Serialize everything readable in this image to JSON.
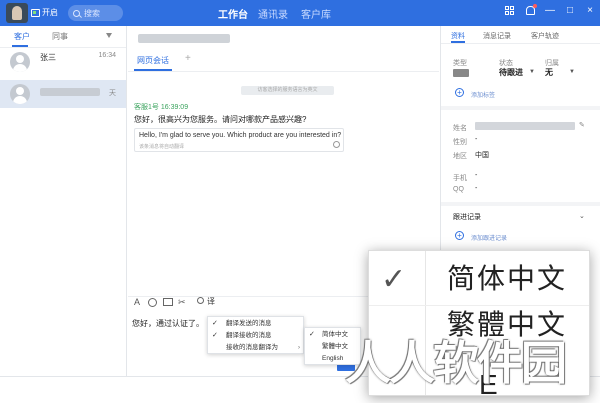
{
  "topbar": {
    "status": "开启",
    "search_placeholder": "搜索",
    "tabs": [
      "工作台",
      "通讯录",
      "客户库"
    ],
    "window_controls": [
      "—",
      "□",
      "×"
    ]
  },
  "left": {
    "tabs": [
      "客户",
      "同事"
    ],
    "contacts": [
      {
        "name": "张三",
        "time": "16:34"
      },
      {
        "name": "",
        "time": "天"
      }
    ]
  },
  "chat": {
    "tab": "网页会话",
    "add_tab": "+",
    "system_note": "访客选择的服务语言为英文",
    "message": {
      "meta": "客服1号 16:39:09",
      "text": "您好，很高兴为您服务。请问对哪款产品感兴趣?",
      "translation": "Hello, I'm glad to serve you. Which product are you interested in?",
      "translation_note": "该条消息将自动翻译"
    },
    "toolbar": {
      "font": "A",
      "trans": "译"
    },
    "input_text": "您好，通过认证了。",
    "menu": {
      "items": [
        {
          "label": "翻译发送的消息",
          "checked": "✓"
        },
        {
          "label": "翻译接收的消息",
          "checked": "✓"
        },
        {
          "label": "接收的消息翻译为",
          "arrow": "›"
        }
      ],
      "submenu": [
        {
          "label": "简体中文",
          "checked": "✓"
        },
        {
          "label": "繁體中文"
        },
        {
          "label": "English"
        }
      ]
    }
  },
  "right": {
    "tabs": [
      "资料",
      "消息记录",
      "客户轨迹"
    ],
    "type_label": "类型",
    "status_label": "状态",
    "status_value": "待跟进",
    "owner_label": "归属",
    "owner_value": "无",
    "add_tag": "添加标签",
    "fields": [
      {
        "label": "姓名",
        "value": ""
      },
      {
        "label": "性别",
        "value": "-"
      },
      {
        "label": "地区",
        "value": "中国"
      },
      {
        "label": "手机",
        "value": "-"
      },
      {
        "label": "QQ",
        "value": "-"
      }
    ],
    "followup_title": "跟进记录",
    "add_followup": "添加跟进记录"
  },
  "zoom": {
    "check": "✓",
    "items": [
      "简体中文",
      "繁體中文",
      "E"
    ]
  },
  "watermark": "人人软件园"
}
